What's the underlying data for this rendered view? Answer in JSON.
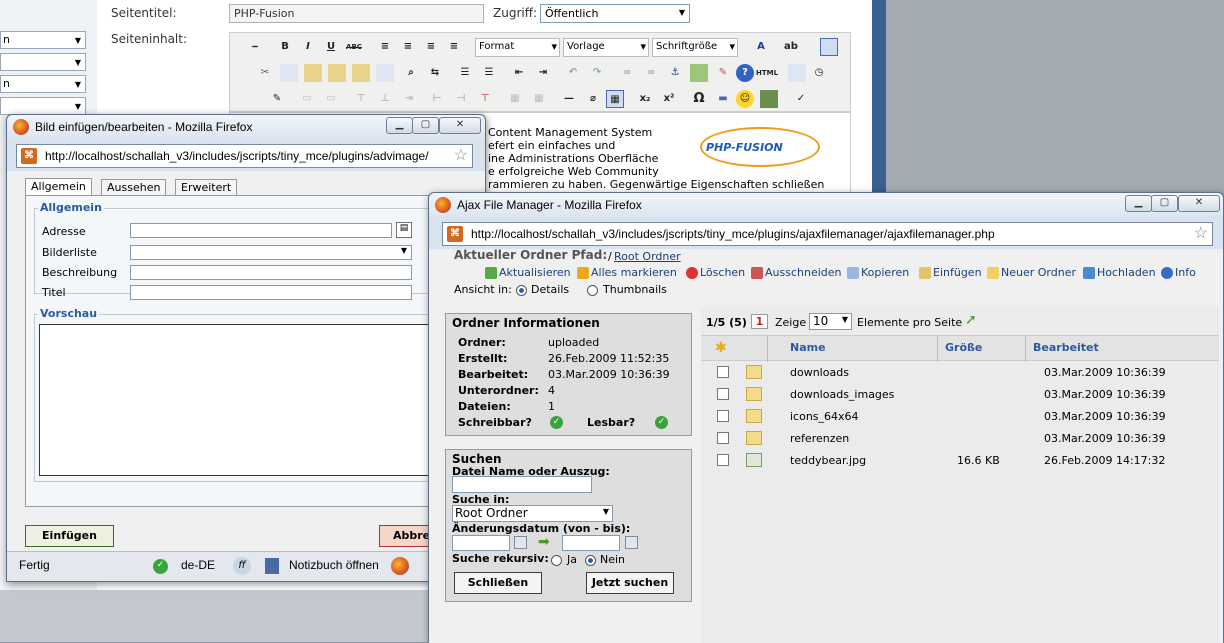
{
  "editor": {
    "left_menu": [
      "n",
      "",
      "n",
      ""
    ],
    "seitentitel_label": "Seitentitel:",
    "seitentitel_value": "PHP-Fusion",
    "zugriff_label": "Zugriff:",
    "zugriff_value": "Öffentlich",
    "seiteninhalt_label": "Seiteninhalt:",
    "toolbar": {
      "format": "Format",
      "vorlage": "Vorlage",
      "schriftgroesse": "Schriftgröße",
      "bold": "B",
      "italic": "I",
      "underline": "U",
      "strike": "ABC",
      "html": "HTML",
      "sub": "x₂",
      "sup": "x²",
      "omega": "Ω"
    },
    "content_lines": [
      "Content Management System",
      "efert ein einfaches und",
      "ine Administrations Oberfläche",
      "e erfolgreiche Web Community",
      "rammieren zu haben. Gegenwärtige Eigenschaften schließen"
    ],
    "logo_text": "PHP-FUSION"
  },
  "bild_window": {
    "title": "Bild einfügen/bearbeiten - Mozilla Firefox",
    "url": "http://localhost/schallah_v3/includes/jscripts/tiny_mce/plugins/advimage/",
    "tabs": [
      "Allgemein",
      "Aussehen",
      "Erweitert"
    ],
    "section_general": "Allgemein",
    "fields": [
      "Adresse",
      "Bilderliste",
      "Beschreibung",
      "Titel"
    ],
    "section_preview": "Vorschau",
    "insert_button": "Einfügen",
    "cancel_button": "Abbre",
    "status": {
      "text": "Fertig",
      "lang": "de-DE",
      "notebook": "Notizbuch öffnen"
    }
  },
  "afm_window": {
    "title": "Ajax File Manager - Mozilla Firefox",
    "url": "http://localhost/schallah_v3/includes/jscripts/tiny_mce/plugins/ajaxfilemanager/ajaxfilemanager.php",
    "path_label": "Aktueller Ordner Pfad:",
    "path_sep": "/",
    "path_link": "Root Ordner",
    "actions": [
      "Aktualisieren",
      "Alles markieren",
      "Löschen",
      "Ausschneiden",
      "Kopieren",
      "Einfügen",
      "Neuer Ordner",
      "Hochladen",
      "Info"
    ],
    "view_label": "Ansicht in:",
    "view_options": [
      "Details",
      "Thumbnails"
    ],
    "info": {
      "title": "Ordner Informationen",
      "rows": [
        {
          "label": "Ordner:",
          "value": "uploaded"
        },
        {
          "label": "Erstellt:",
          "value": "26.Feb.2009 11:52:35"
        },
        {
          "label": "Bearbeitet:",
          "value": "03.Mar.2009 10:36:39"
        },
        {
          "label": "Unterordner:",
          "value": "4"
        },
        {
          "label": "Dateien:",
          "value": "1"
        }
      ],
      "writable": "Schreibbar?",
      "readable": "Lesbar?"
    },
    "search": {
      "title": "Suchen",
      "name_label": "Datei Name oder Auszug:",
      "in_label": "Suche in:",
      "in_value": "Root Ordner",
      "date_label": "Änderungsdatum (von - bis):",
      "recursive_label": "Suche rekursiv:",
      "yes": "Ja",
      "no": "Nein",
      "close_button": "Schließen",
      "search_button": "Jetzt suchen"
    },
    "pager": {
      "count": "1/5 (5)",
      "page": "1",
      "show": "Zeige",
      "per_page": "10",
      "per_page_label": "Elemente pro Seite"
    },
    "columns": {
      "name": "Name",
      "size": "Größe",
      "modified": "Bearbeitet"
    },
    "files": [
      {
        "name": "downloads",
        "size": "",
        "date": "03.Mar.2009 10:36:39",
        "type": "folder"
      },
      {
        "name": "downloads_images",
        "size": "",
        "date": "03.Mar.2009 10:36:39",
        "type": "folder"
      },
      {
        "name": "icons_64x64",
        "size": "",
        "date": "03.Mar.2009 10:36:39",
        "type": "folder"
      },
      {
        "name": "referenzen",
        "size": "",
        "date": "03.Mar.2009 10:36:39",
        "type": "folder"
      },
      {
        "name": "teddybear.jpg",
        "size": "16.6 KB",
        "date": "26.Feb.2009 14:17:32",
        "type": "image"
      }
    ]
  }
}
